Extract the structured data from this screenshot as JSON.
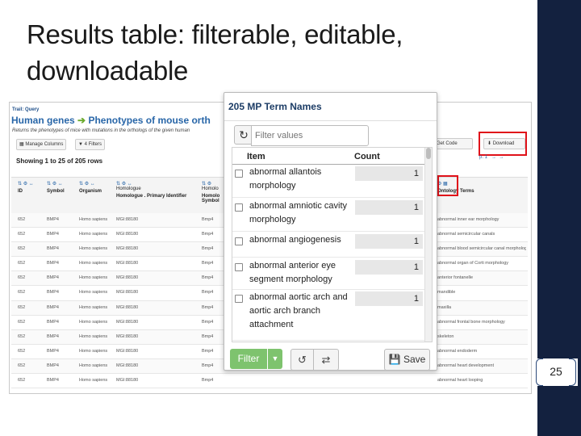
{
  "slide": {
    "title": "Results table: filterable, editable, downloadable",
    "page_number": "25"
  },
  "screenshot": {
    "trail": "Trail: Query",
    "query_left": "Human genes",
    "query_right": "Phenotypes of mouse orth",
    "subtitle": "Returns the phenotypes of mice with mutations in the orthologs of the given human",
    "manage_columns": "Manage Columns",
    "filters": "4 Filters",
    "showing": "Showing 1 to 25 of 205 rows",
    "gen_code": "Get Code",
    "download": "Download",
    "pager": "p. 1",
    "columns": [
      {
        "top": "",
        "name": "ID"
      },
      {
        "top": "",
        "name": "Symbol"
      },
      {
        "top": "",
        "name": "Organism"
      },
      {
        "top": "Homologue",
        "name": "Homologue . Primary Identifier"
      },
      {
        "top": "Homolo",
        "name": "Homolo Symbol"
      }
    ],
    "right_col": "Ontology Terms",
    "rows": [
      {
        "id": "652",
        "sym": "BMP4",
        "org": "Homo sapiens",
        "hid": "MGI:88180",
        "hsym": "Bmp4",
        "term": "abnormal inner ear morphology"
      },
      {
        "id": "652",
        "sym": "BMP4",
        "org": "Homo sapiens",
        "hid": "MGI:88180",
        "hsym": "Bmp4",
        "term": "abnormal semicircular canals"
      },
      {
        "id": "652",
        "sym": "BMP4",
        "org": "Homo sapiens",
        "hid": "MGI:88180",
        "hsym": "Bmp4",
        "term": "abnormal blood semicircular canal morphology"
      },
      {
        "id": "652",
        "sym": "BMP4",
        "org": "Homo sapiens",
        "hid": "MGI:88180",
        "hsym": "Bmp4",
        "term": "abnormal organ of Corti morphology"
      },
      {
        "id": "652",
        "sym": "BMP4",
        "org": "Homo sapiens",
        "hid": "MGI:88180",
        "hsym": "Bmp4",
        "term": "anterior fontanelle"
      },
      {
        "id": "652",
        "sym": "BMP4",
        "org": "Homo sapiens",
        "hid": "MGI:88180",
        "hsym": "Bmp4",
        "term": "mandible"
      },
      {
        "id": "652",
        "sym": "BMP4",
        "org": "Homo sapiens",
        "hid": "MGI:88180",
        "hsym": "Bmp4",
        "term": "maxilla"
      },
      {
        "id": "652",
        "sym": "BMP4",
        "org": "Homo sapiens",
        "hid": "MGI:88180",
        "hsym": "Bmp4",
        "term": "abnormal frontal bone morphology"
      },
      {
        "id": "652",
        "sym": "BMP4",
        "org": "Homo sapiens",
        "hid": "MGI:88180",
        "hsym": "Bmp4",
        "term": "skeleton"
      },
      {
        "id": "652",
        "sym": "BMP4",
        "org": "Homo sapiens",
        "hid": "MGI:88180",
        "hsym": "Bmp4",
        "term": "abnormal endoderm"
      },
      {
        "id": "652",
        "sym": "BMP4",
        "org": "Homo sapiens",
        "hid": "MGI:88180",
        "hsym": "Bmp4",
        "term": "abnormal heart development"
      },
      {
        "id": "652",
        "sym": "BMP4",
        "org": "Homo sapiens",
        "hid": "MGI:88180",
        "hsym": "Bmp4",
        "term": "abnormal heart looping"
      }
    ]
  },
  "popup": {
    "title": "205 MP Term Names",
    "filter_placeholder": "Filter values",
    "col_item": "Item",
    "col_count": "Count",
    "items": [
      {
        "name": "abnormal allantois morphology",
        "count": "1"
      },
      {
        "name": "abnormal amniotic cavity morphology",
        "count": "1"
      },
      {
        "name": "abnormal angiogenesis",
        "count": "1"
      },
      {
        "name": "abnormal anterior eye segment morphology",
        "count": "1"
      },
      {
        "name": "abnormal aortic arch and aortic arch branch attachment",
        "count": "1"
      }
    ],
    "filter_button": "Filter",
    "save_button": "Save"
  },
  "colors": {
    "accent_bar": "#13213f",
    "highlight_red": "#e0121a",
    "filter_green": "#7ec36e"
  },
  "icons": [
    "refresh-icon",
    "caret-down-icon",
    "undo-icon",
    "swap-icon",
    "save-icon",
    "download-icon"
  ]
}
